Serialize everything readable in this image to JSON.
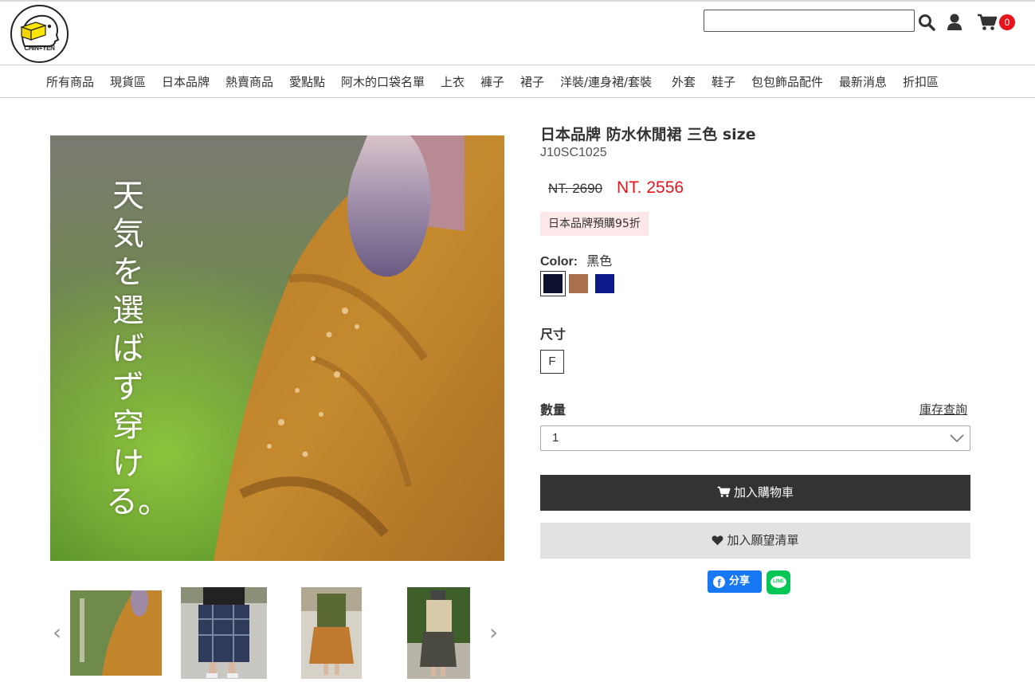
{
  "header": {
    "logo_text": "CHiN+YEN",
    "search_value": "",
    "cart_count": "0"
  },
  "nav": {
    "items": [
      "所有商品",
      "現貨區",
      "日本品牌",
      "熱賣商品",
      "愛點點",
      "阿木的口袋名單",
      "上衣",
      "褲子",
      "裙子",
      "洋裝/連身裙/套裝",
      "外套",
      "鞋子",
      "包包飾品配件",
      "最新消息",
      "折扣區"
    ]
  },
  "gallery": {
    "main_overlay_text": "天気を選ばず穿ける。",
    "thumb_count": 4
  },
  "product": {
    "title": "日本品牌 防水休閒裙 三色 size",
    "sku": "J10SC1025",
    "price_old": "NT. 2690",
    "price_new": "NT. 2556",
    "promo_tag": "日本品牌預購95折",
    "color_label": "Color:",
    "color_value": "黑色",
    "colors": [
      "#0d1130",
      "#a8704c",
      "#0c1a8a"
    ],
    "size_label": "尺寸",
    "size_option": "F",
    "qty_label": "數量",
    "stock_link": "庫存查詢",
    "qty_value": "1",
    "add_to_cart": "加入購物車",
    "add_to_wishlist": "加入願望清單"
  },
  "share": {
    "fb_label": "分享",
    "fb_letter": "f",
    "line_label": "LINE"
  }
}
